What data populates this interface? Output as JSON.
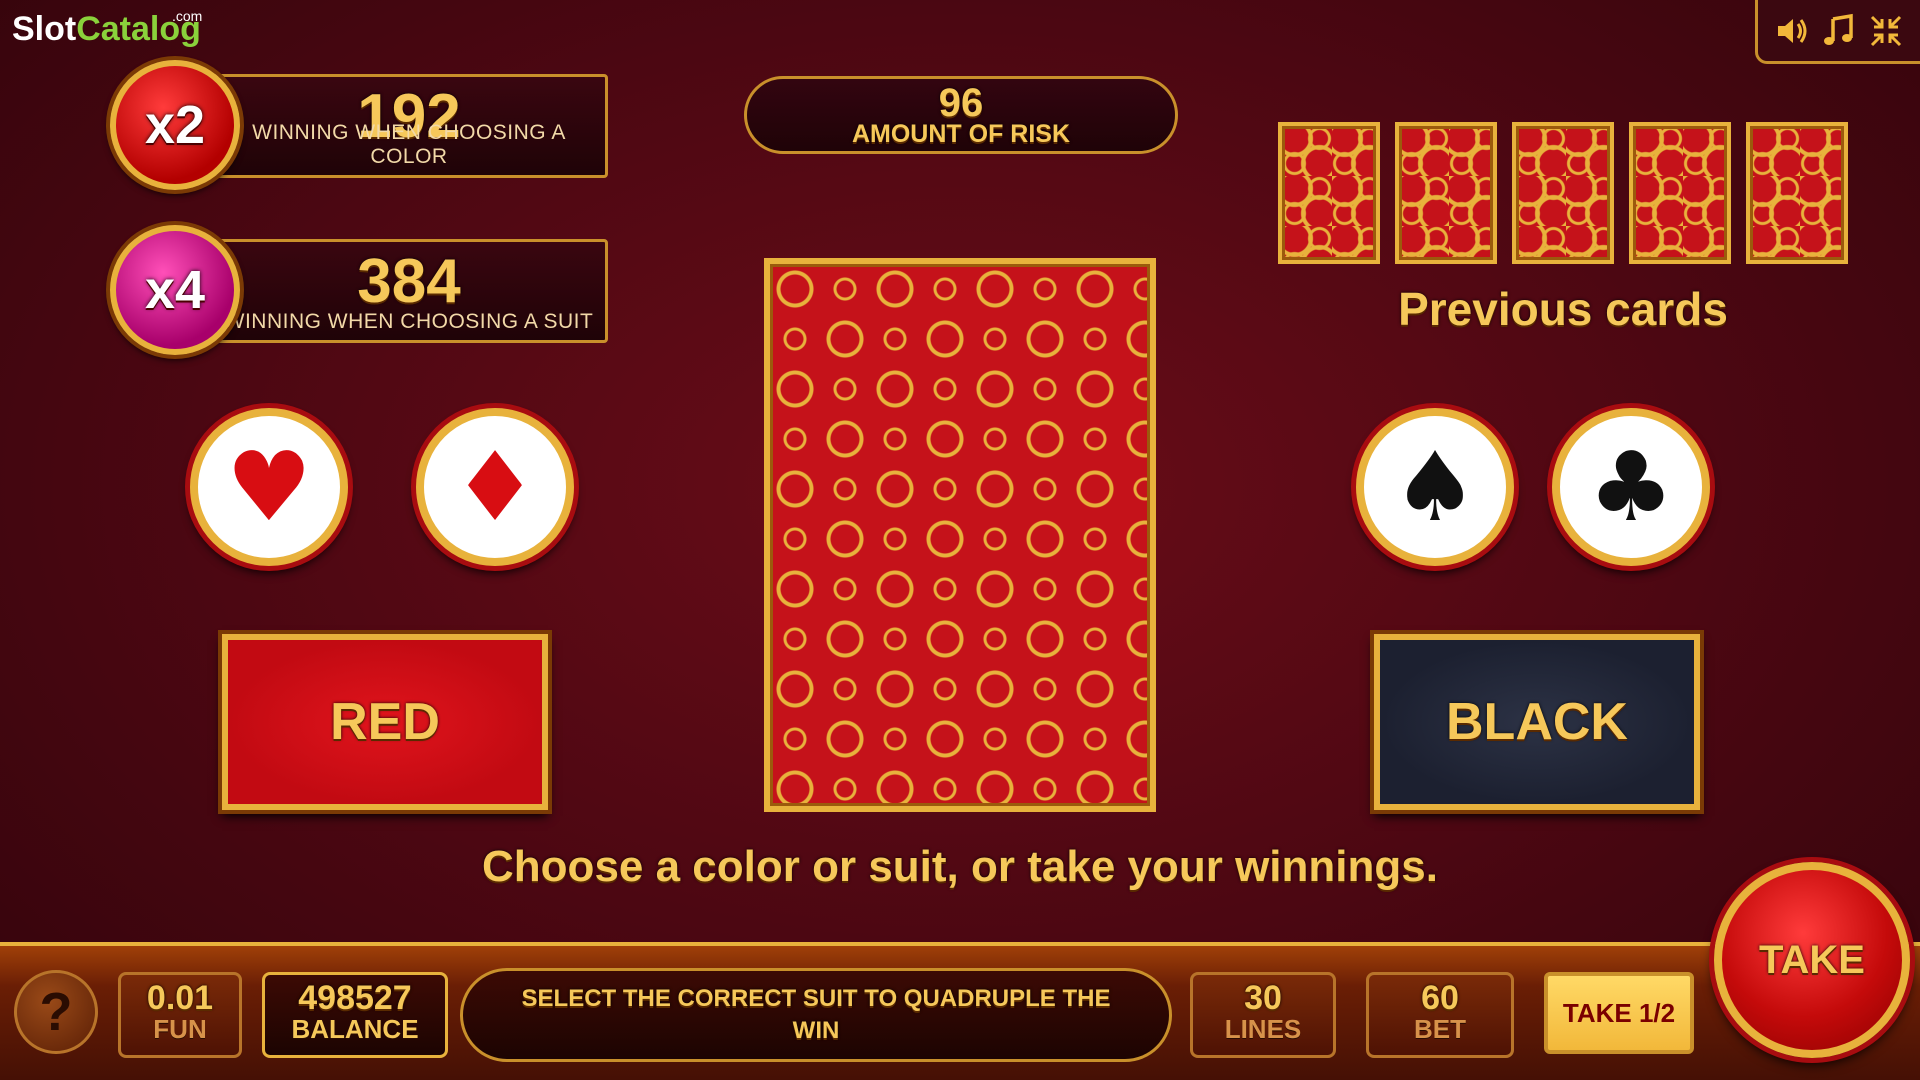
{
  "logo": {
    "slot": "Slot",
    "catalog": "Catalog",
    "com": ".com"
  },
  "controls": {
    "sound_icon": "speaker-icon",
    "music_icon": "music-note-icon",
    "fullscreen_icon": "minimize-icon"
  },
  "multipliers": [
    {
      "badge": "x2",
      "value": "192",
      "label": "WINNING WHEN CHOOSING A COLOR",
      "color": "#d81818"
    },
    {
      "badge": "x4",
      "value": "384",
      "label": "WINNING WHEN CHOOSING A SUIT",
      "color": "#d41a8c"
    }
  ],
  "risk": {
    "value": "96",
    "label": "AMOUNT OF RISK"
  },
  "previous_cards": {
    "label": "Previous cards",
    "count": 5
  },
  "suits": {
    "hearts": "♥",
    "diamonds": "♦",
    "spades": "♠",
    "clubs": "♣"
  },
  "buttons": {
    "red": "RED",
    "black": "BLACK",
    "take": "TAKE",
    "take_half": "TAKE 1/2",
    "help": "?"
  },
  "instruction": "Choose a color or suit, or take your winnings.",
  "bottom": {
    "coin_value": "0.01",
    "coin_label": "FUN",
    "balance_value": "498527",
    "balance_label": "BALANCE",
    "message": "SELECT THE CORRECT SUIT TO QUADRUPLE THE WIN",
    "lines_value": "30",
    "lines_label": "LINES",
    "bet_value": "60",
    "bet_label": "BET"
  },
  "colors": {
    "gold": "#e8b23c",
    "card_red": "#c5121a",
    "background": "#4c0712"
  }
}
